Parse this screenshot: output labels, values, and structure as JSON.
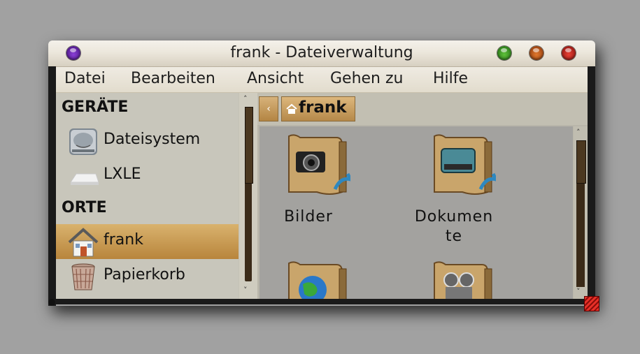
{
  "window": {
    "title": "frank - Dateiverwaltung"
  },
  "menubar": {
    "items": [
      "Datei",
      "Bearbeiten",
      "Ansicht",
      "Gehen zu",
      "Hilfe"
    ]
  },
  "sidebar": {
    "sections": [
      {
        "header": "GERÄTE",
        "items": [
          {
            "label": "Dateisystem",
            "icon": "harddisk-icon"
          },
          {
            "label": "LXLE",
            "icon": "drive-icon"
          }
        ]
      },
      {
        "header": "ORTE",
        "items": [
          {
            "label": "frank",
            "icon": "home-icon",
            "selected": true
          },
          {
            "label": "Papierkorb",
            "icon": "trash-icon"
          }
        ]
      }
    ]
  },
  "pathbar": {
    "back": "‹",
    "current": "frank"
  },
  "files": [
    {
      "label": "Bilder",
      "icon": "pictures-folder-icon"
    },
    {
      "label": "Dokumente",
      "label_line1": "Dokumen",
      "label_line2": "te",
      "icon": "documents-folder-icon"
    },
    {
      "label": "",
      "icon": "public-folder-icon"
    },
    {
      "label": "",
      "icon": "videos-folder-icon"
    }
  ],
  "scroll": {
    "up": "˄",
    "down": "˅"
  }
}
